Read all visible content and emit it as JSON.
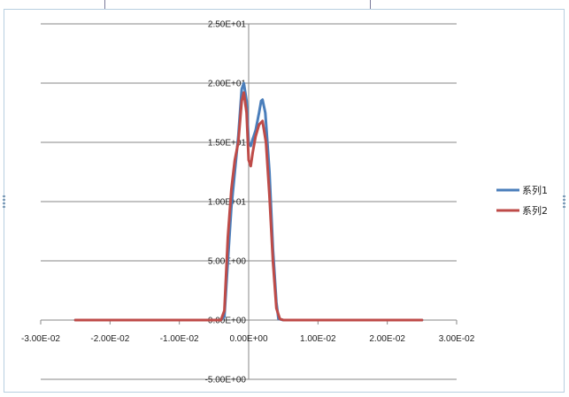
{
  "chart_data": {
    "type": "line",
    "title": "",
    "xlabel": "",
    "ylabel": "",
    "xlim": [
      -0.03,
      0.03
    ],
    "ylim": [
      -5,
      25
    ],
    "x_ticks": [
      -0.03,
      -0.02,
      -0.01,
      0,
      0.01,
      0.02,
      0.03
    ],
    "x_tick_labels": [
      "-3.00E-02",
      "-2.00E-02",
      "-1.00E-02",
      "0.00E+00",
      "1.00E-02",
      "2.00E-02",
      "3.00E-02"
    ],
    "y_ticks": [
      -5,
      0,
      5,
      10,
      15,
      20,
      25
    ],
    "y_tick_labels": [
      "-5.00E+00",
      "0.00E+00",
      "5.00E+00",
      "1.00E+01",
      "1.50E+01",
      "2.00E+01",
      "2.50E+01"
    ],
    "grid": "horizontal",
    "legend_position": "right",
    "series": [
      {
        "name": "系列1",
        "color": "#4a7ebb",
        "points": [
          [
            -0.025,
            0
          ],
          [
            -0.004,
            0
          ],
          [
            -0.0035,
            0.3
          ],
          [
            -0.003,
            5
          ],
          [
            -0.0025,
            9.5
          ],
          [
            -0.002,
            12.5
          ],
          [
            -0.0015,
            15.5
          ],
          [
            -0.001,
            19.5
          ],
          [
            -0.0007,
            20
          ],
          [
            -0.0003,
            18.5
          ],
          [
            0.0,
            15.0
          ],
          [
            0.0003,
            14.7
          ],
          [
            0.0006,
            15.3
          ],
          [
            0.001,
            16.0
          ],
          [
            0.0015,
            17.5
          ],
          [
            0.0018,
            18.5
          ],
          [
            0.002,
            18.6
          ],
          [
            0.0024,
            17.5
          ],
          [
            0.003,
            12.5
          ],
          [
            0.0035,
            6.0
          ],
          [
            0.004,
            1.5
          ],
          [
            0.0043,
            0.1
          ],
          [
            0.005,
            0
          ],
          [
            0.025,
            0
          ]
        ]
      },
      {
        "name": "系列2",
        "color": "#be4b48",
        "points": [
          [
            -0.025,
            0
          ],
          [
            -0.004,
            0
          ],
          [
            -0.0035,
            0.8
          ],
          [
            -0.003,
            7
          ],
          [
            -0.0025,
            11
          ],
          [
            -0.002,
            13.5
          ],
          [
            -0.0015,
            15.0
          ],
          [
            -0.001,
            18.5
          ],
          [
            -0.0007,
            19.2
          ],
          [
            -0.0003,
            17.5
          ],
          [
            0.0,
            13.5
          ],
          [
            0.0003,
            13.0
          ],
          [
            0.0006,
            14.2
          ],
          [
            0.001,
            15.5
          ],
          [
            0.0015,
            16.5
          ],
          [
            0.002,
            16.8
          ],
          [
            0.0025,
            15.0
          ],
          [
            0.003,
            10.5
          ],
          [
            0.0035,
            5.0
          ],
          [
            0.004,
            1.0
          ],
          [
            0.0045,
            0.1
          ],
          [
            0.005,
            0
          ],
          [
            0.025,
            0
          ]
        ]
      }
    ]
  }
}
